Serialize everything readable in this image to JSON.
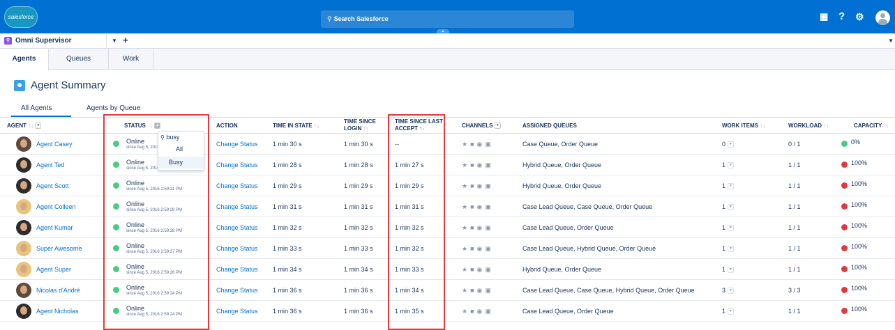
{
  "header": {
    "logo_text": "salesforce",
    "search_placeholder": "Search Salesforce",
    "search_icon": "search-icon",
    "icons": [
      "app-launcher-icon",
      "help-icon",
      "setup-gear-icon",
      "user-avatar-icon"
    ],
    "help_glyph": "?"
  },
  "workspace": {
    "tab_label": "Omni Supervisor",
    "tab_icon": "omni-supervisor-icon",
    "plus": "+"
  },
  "subtabs": [
    "Agents",
    "Queues",
    "Work"
  ],
  "page": {
    "title": "Agent Summary",
    "icon": "agent-summary-icon",
    "views": [
      "All Agents",
      "Agents by Queue"
    ]
  },
  "columns": {
    "agent": "AGENT",
    "status": "STATUS",
    "action": "ACTION",
    "time_in_state": "TIME IN STATE",
    "time_since_login": "TIME SINCE LOGIN",
    "time_since_last_accept": "TIME SINCE LAST ACCEPT",
    "channels": "CHANNELS",
    "assigned_queues": "ASSIGNED QUEUES",
    "work_items": "WORK ITEMS",
    "workload": "WORKLOAD",
    "capacity": "CAPACITY"
  },
  "status_filter": {
    "search_value": "busy",
    "options": [
      "All",
      "Busy"
    ],
    "selected": "Busy"
  },
  "colors": {
    "header_blue": "#0070d2",
    "online_green": "#4bca81",
    "capacity_green": "#4bca81",
    "capacity_red": "#e0393e",
    "highlight_red": "#e0393e",
    "link_blue": "#0070d2"
  },
  "rows": [
    {
      "agent": "Agent Casey",
      "status": "Online",
      "since": "since Aug 5, 2016 2:59:35 PM",
      "action": "Change Status",
      "time_in_state": "1 min 30 s",
      "time_since_login": "1 min 30 s",
      "time_since_last_accept": "--",
      "queues": "Case Queue, Order Queue",
      "work_items": "0",
      "workload": "0 / 1",
      "capacity": "0%",
      "capacity_color": "green"
    },
    {
      "agent": "Agent Ted",
      "status": "Online",
      "since": "since Aug 5, 2016 2:59:33 PM",
      "action": "Change Status",
      "time_in_state": "1 min 28 s",
      "time_since_login": "1 min 28 s",
      "time_since_last_accept": "1 min 27 s",
      "queues": "Hybrid Queue, Order Queue",
      "work_items": "1",
      "workload": "1 / 1",
      "capacity": "100%",
      "capacity_color": "red"
    },
    {
      "agent": "Agent Scott",
      "status": "Online",
      "since": "since Aug 5, 2016 2:59:31 PM",
      "action": "Change Status",
      "time_in_state": "1 min 29 s",
      "time_since_login": "1 min 29 s",
      "time_since_last_accept": "1 min 29 s",
      "queues": "Hybrid Queue, Order Queue",
      "work_items": "1",
      "workload": "1 / 1",
      "capacity": "100%",
      "capacity_color": "red"
    },
    {
      "agent": "Agent Colleen",
      "status": "Online",
      "since": "since Aug 5, 2016 2:59:29 PM",
      "action": "Change Status",
      "time_in_state": "1 min 31 s",
      "time_since_login": "1 min 31 s",
      "time_since_last_accept": "1 min 31 s",
      "queues": "Case Lead Queue, Case Queue, Order Queue",
      "work_items": "1",
      "workload": "1 / 1",
      "capacity": "100%",
      "capacity_color": "red"
    },
    {
      "agent": "Agent Kumar",
      "status": "Online",
      "since": "since Aug 5, 2016 2:59:28 PM",
      "action": "Change Status",
      "time_in_state": "1 min 32 s",
      "time_since_login": "1 min 32 s",
      "time_since_last_accept": "1 min 32 s",
      "queues": "Case Lead Queue, Order Queue",
      "work_items": "1",
      "workload": "1 / 1",
      "capacity": "100%",
      "capacity_color": "red"
    },
    {
      "agent": "Super Awesome",
      "status": "Online",
      "since": "since Aug 5, 2016 2:59:27 PM",
      "action": "Change Status",
      "time_in_state": "1 min 33 s",
      "time_since_login": "1 min 33 s",
      "time_since_last_accept": "1 min 32 s",
      "queues": "Case Lead Queue, Hybrid Queue, Order Queue",
      "work_items": "1",
      "workload": "1 / 1",
      "capacity": "100%",
      "capacity_color": "red"
    },
    {
      "agent": "Agent Super",
      "status": "Online",
      "since": "since Aug 5, 2016 2:59:26 PM",
      "action": "Change Status",
      "time_in_state": "1 min 34 s",
      "time_since_login": "1 min 34 s",
      "time_since_last_accept": "1 min 33 s",
      "queues": "Hybrid Queue, Order Queue",
      "work_items": "1",
      "workload": "1 / 1",
      "capacity": "100%",
      "capacity_color": "red"
    },
    {
      "agent": "Nicolas d'André",
      "status": "Online",
      "since": "since Aug 5, 2016 2:59:24 PM",
      "action": "Change Status",
      "time_in_state": "1 min 36 s",
      "time_since_login": "1 min 36 s",
      "time_since_last_accept": "1 min 34 s",
      "queues": "Case Lead Queue, Case Queue, Hybrid Queue, Order Queue",
      "work_items": "3",
      "workload": "3 / 3",
      "capacity": "100%",
      "capacity_color": "red"
    },
    {
      "agent": "Agent Nicholas",
      "status": "Online",
      "since": "since Aug 5, 2016 2:59:24 PM",
      "action": "Change Status",
      "time_in_state": "1 min 36 s",
      "time_since_login": "1 min 36 s",
      "time_since_last_accept": "1 min 35 s",
      "queues": "Case Lead Queue, Order Queue",
      "work_items": "1",
      "workload": "1 / 1",
      "capacity": "100%",
      "capacity_color": "red"
    }
  ]
}
